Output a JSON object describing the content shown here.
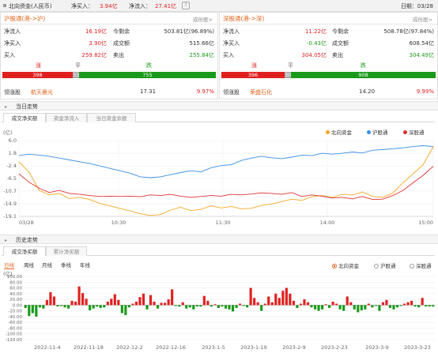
{
  "topbar": {
    "title": "北向资金(人民币)",
    "net_buy_label": "净买入：",
    "net_buy_value": "3.94亿",
    "net_inflow_label": "净流入：",
    "net_inflow_value": "27.41亿",
    "help": "?",
    "date": "日期：03/28"
  },
  "sh": {
    "title": "沪股通(港->沪)",
    "link": "成份股>",
    "inflow_label": "净流入",
    "inflow_value": "16.19亿",
    "balance_label": "今剩余",
    "balance_value": "503.81亿(96.89%)",
    "netbuy_label": "净买入",
    "netbuy_value": "3.90亿",
    "turnover_label": "成交额",
    "turnover_value": "515.66亿",
    "buy_label": "买入",
    "buy_value": "259.82亿",
    "sell_label": "卖出",
    "sell_value": "255.84亿",
    "up_label": "涨",
    "flat_label": "平",
    "down_label": "跌",
    "up_count": "398",
    "flat_count": "33",
    "down_count": "755",
    "leader_label": "领涨股",
    "leader_name": "航天晨光",
    "leader_price": "17.31",
    "leader_pct": "9.97%"
  },
  "sz": {
    "title": "深股通(港->深)",
    "link": "成份股>",
    "inflow_label": "净流入",
    "inflow_value": "11.22亿",
    "balance_label": "今剩余",
    "balance_value": "508.78亿(97.84%)",
    "netbuy_label": "净买入",
    "netbuy_value": "-0.43亿",
    "turnover_label": "成交额",
    "turnover_value": "608.54亿",
    "buy_label": "买入",
    "buy_value": "304.05亿",
    "sell_label": "卖出",
    "sell_value": "304.49亿",
    "up_label": "涨",
    "flat_label": "平",
    "down_label": "跌",
    "up_count": "396",
    "flat_count": "30",
    "down_count": "908",
    "leader_label": "领涨股",
    "leader_name": "荣盛石化",
    "leader_price": "14.20",
    "leader_pct": "9.99%"
  },
  "intraday": {
    "section_title": "当日走势",
    "tabs": [
      "成交净买额",
      "资金净流入",
      "当日资金余额"
    ],
    "legend": [
      "北向资金",
      "沪股通",
      "深股通"
    ],
    "colors": {
      "north": "#f5a623",
      "sh": "#3a8ee6",
      "sz": "#e03030"
    }
  },
  "history": {
    "section_title": "历史走势",
    "tabs": [
      "成交净买额",
      "累计净买额"
    ],
    "periods": [
      "日线",
      "周线",
      "月线",
      "季线",
      "年线"
    ],
    "radios": [
      "北向资金",
      "沪股通",
      "深股通"
    ]
  },
  "chart_data": [
    {
      "type": "line",
      "title": "",
      "ylabel": "(亿)",
      "y_ticks": [
        "6.0",
        "1.8",
        "-2.4",
        "-6.5",
        "-10.7",
        "-14.9",
        "-19.1"
      ],
      "ylim": [
        -19.1,
        6.0
      ],
      "x_ticks": [
        "03/28",
        "10:30",
        "11:30",
        "14:00",
        "15:00"
      ],
      "series": [
        {
          "name": "北向资金",
          "values": [
            -1.0,
            -4.5,
            -10.5,
            -12.0,
            -11.5,
            -13.2,
            -12.8,
            -13.5,
            -14.8,
            -15.6,
            -16.5,
            -17.3,
            -18.2,
            -18.8,
            -18.5,
            -17.0,
            -16.1,
            -17.2,
            -16.8,
            -15.6,
            -16.3,
            -15.8,
            -16.6,
            -16.4,
            -15.5,
            -15.0,
            -14.2,
            -13.4,
            -13.8,
            -12.6,
            -12.2,
            -12.8,
            -11.8,
            -12.0,
            -11.0,
            -12.5,
            -12.8,
            -11.4,
            -8.0,
            -5.0,
            -2.0,
            3.9
          ]
        },
        {
          "name": "沪股通",
          "values": [
            1.0,
            1.5,
            1.2,
            0.8,
            0.2,
            -0.4,
            -1.0,
            -1.6,
            -2.4,
            -3.2,
            -4.0,
            -4.8,
            -6.0,
            -6.3,
            -6.0,
            -5.3,
            -4.6,
            -4.0,
            -4.4,
            -3.0,
            -2.3,
            -2.0,
            -0.6,
            0.2,
            0.8,
            0.3,
            0.0,
            0.5,
            1.2,
            1.0,
            1.8,
            1.5,
            1.8,
            2.2,
            1.9,
            2.8,
            3.0,
            3.3,
            3.6,
            4.0,
            4.3,
            4.0
          ]
        },
        {
          "name": "深股通",
          "values": [
            -5.0,
            -7.8,
            -9.8,
            -11.2,
            -10.5,
            -11.5,
            -11.8,
            -12.2,
            -12.5,
            -12.4,
            -12.5,
            -12.4,
            -12.6,
            -12.0,
            -12.2,
            -11.8,
            -12.4,
            -12.8,
            -12.5,
            -12.2,
            -12.4,
            -11.8,
            -12.0,
            -11.7,
            -11.3,
            -11.5,
            -11.8,
            -11.2,
            -12.5,
            -12.0,
            -12.4,
            -13.0,
            -12.8,
            -13.3,
            -12.5,
            -13.5,
            -13.4,
            -12.2,
            -10.5,
            -8.0,
            -5.5,
            -2.5
          ]
        }
      ]
    },
    {
      "type": "bar",
      "title": "",
      "ylabel": "(亿)",
      "y_ticks": [
        "100.00",
        "80.00",
        "60.00",
        "40.00",
        "20.00",
        "0.00",
        "-20.00",
        "-40.00",
        "-60.00",
        "-80.00",
        "-100.00",
        "-120.00"
      ],
      "ylim": [
        -120,
        100
      ],
      "x_ticks": [
        "2022-11-4",
        "2022-11-18",
        "2022-12-2",
        "2022-12-16",
        "2023-1-5",
        "2023-1-19",
        "2023-2-9",
        "2023-2-23",
        "2023-3-9",
        "2023-3-23"
      ],
      "values": [
        -10,
        -38,
        -28,
        -40,
        -8,
        -12,
        18,
        45,
        30,
        -5,
        -3,
        -8,
        -12,
        15,
        12,
        65,
        42,
        22,
        -18,
        -12,
        -5,
        -10,
        -8,
        12,
        22,
        38,
        18,
        -28,
        -35,
        -8,
        5,
        12,
        28,
        40,
        -15,
        35,
        12,
        -12,
        8,
        8,
        20,
        55,
        -3,
        -5,
        10,
        -12,
        -8,
        -15,
        -5,
        -5,
        32,
        15,
        -5,
        3,
        -10,
        -5,
        -12,
        -15,
        -22,
        -10,
        5,
        -3,
        -8,
        60,
        25,
        10,
        -20,
        5,
        30,
        10,
        40,
        25,
        50,
        60,
        40,
        15,
        -10,
        5,
        20,
        10,
        -8,
        -15,
        -20,
        -15,
        3,
        -10,
        12,
        5,
        -15,
        -20,
        30,
        10,
        -15,
        -25,
        -18,
        -15,
        5,
        -8,
        -3,
        -20,
        10,
        18,
        -10,
        -15,
        -8,
        -3,
        5,
        10,
        15,
        -5,
        -8,
        25,
        -5,
        -5,
        -5
      ]
    }
  ]
}
